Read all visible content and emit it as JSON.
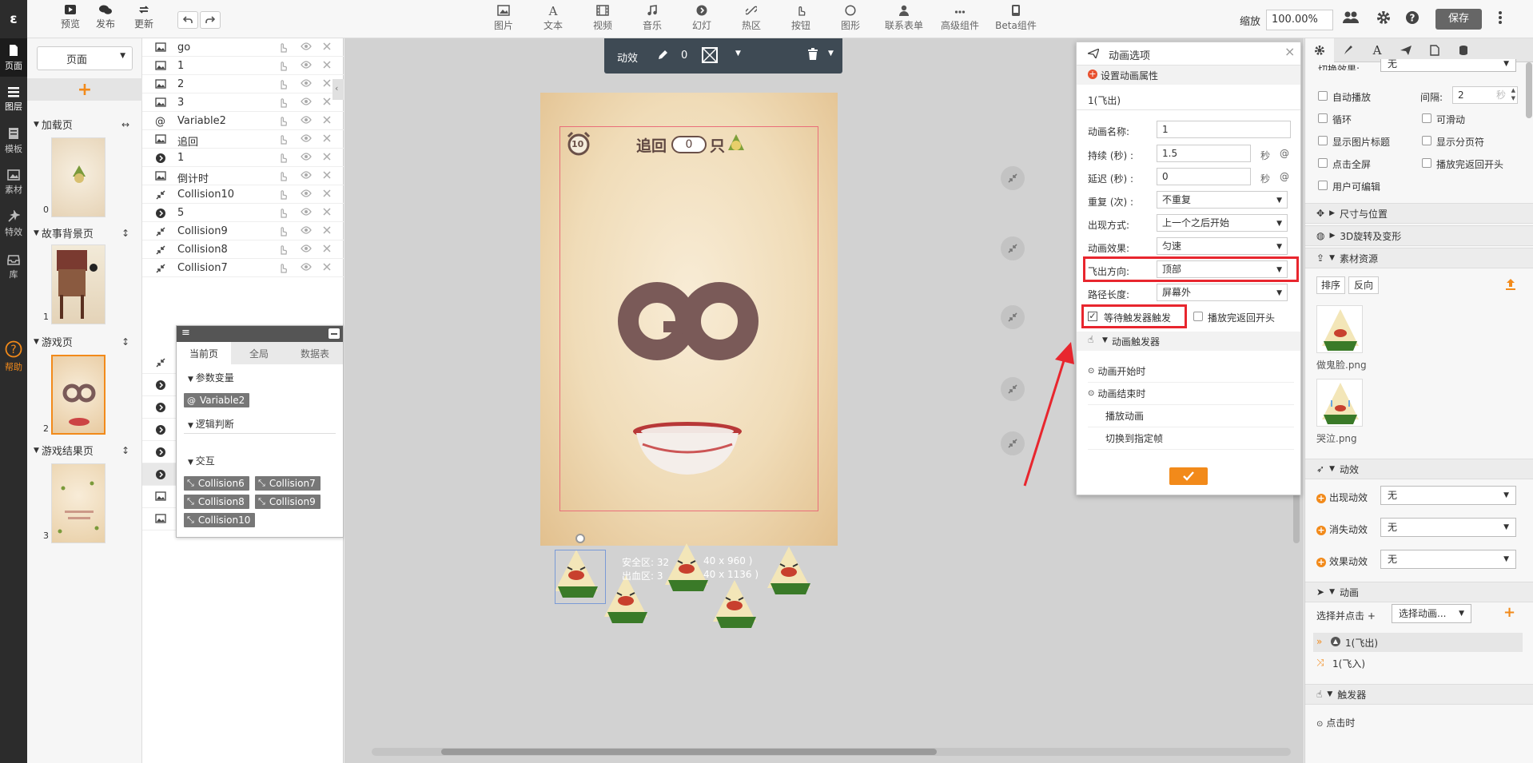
{
  "leftbar": {
    "logo": "ε",
    "items": [
      {
        "label": "页面",
        "icon": "page-icon"
      },
      {
        "label": "图层",
        "icon": "layers-icon"
      },
      {
        "label": "模板",
        "icon": "template-icon"
      },
      {
        "label": "素材",
        "icon": "image-icon"
      },
      {
        "label": "特效",
        "icon": "effect-icon"
      },
      {
        "label": "库",
        "icon": "library-icon"
      },
      {
        "label": "帮助",
        "icon": "help-icon"
      }
    ]
  },
  "toolbar": {
    "file_actions": [
      {
        "label": "预览",
        "icon": "preview-icon"
      },
      {
        "label": "发布",
        "icon": "publish-icon"
      },
      {
        "label": "更新",
        "icon": "update-icon"
      }
    ],
    "components": [
      {
        "label": "图片",
        "icon": "picture-icon"
      },
      {
        "label": "文本",
        "icon": "text-icon"
      },
      {
        "label": "视频",
        "icon": "video-icon"
      },
      {
        "label": "音乐",
        "icon": "music-icon"
      },
      {
        "label": "幻灯",
        "icon": "slideshow-icon"
      },
      {
        "label": "热区",
        "icon": "hotspot-icon"
      },
      {
        "label": "按钮",
        "icon": "button-icon"
      },
      {
        "label": "图形",
        "icon": "shape-icon"
      },
      {
        "label": "联系表单",
        "icon": "form-icon"
      },
      {
        "label": "高级组件",
        "icon": "advanced-icon"
      },
      {
        "label": "Beta组件",
        "icon": "beta-icon"
      }
    ],
    "zoom_label": "缩放",
    "zoom_value": "100.00%",
    "save_label": "保存"
  },
  "pages": {
    "select_value": "页面",
    "add_symbol": "+",
    "groups": [
      {
        "name": "加载页",
        "pages": [
          {
            "num": "0"
          }
        ]
      },
      {
        "name": "故事背景页",
        "pages": [
          {
            "num": "1"
          }
        ]
      },
      {
        "name": "游戏页",
        "pages": [
          {
            "num": "2"
          }
        ]
      },
      {
        "name": "游戏结果页",
        "pages": [
          {
            "num": "3"
          }
        ]
      }
    ],
    "group_icon": "↔",
    "group_icon2": "↕"
  },
  "layers": [
    {
      "name": "go",
      "icon": "image-layer"
    },
    {
      "name": "1",
      "icon": "image-layer"
    },
    {
      "name": "2",
      "icon": "image-layer"
    },
    {
      "name": "3",
      "icon": "image-layer"
    },
    {
      "name": "Variable2",
      "icon": "at-layer"
    },
    {
      "name": "追回",
      "icon": "image-layer"
    },
    {
      "name": "1",
      "icon": "circle-layer"
    },
    {
      "name": "倒计时",
      "icon": "image-layer"
    },
    {
      "name": "Collision10",
      "icon": "collision-layer"
    },
    {
      "name": "5",
      "icon": "circle-layer"
    },
    {
      "name": "Collision9",
      "icon": "collision-layer"
    },
    {
      "name": "Collision8",
      "icon": "collision-layer"
    },
    {
      "name": "Collision7",
      "icon": "collision-layer"
    }
  ],
  "var_panel": {
    "tabs": [
      "当前页",
      "全局",
      "数据表"
    ],
    "section_vars": "参数变量",
    "var_chips": [
      "Variable2"
    ],
    "section_logic": "逻辑判断",
    "section_interact": "交互",
    "interact_chips": [
      "Collision6",
      "Collision7",
      "Collision8",
      "Collision9",
      "Collision10"
    ]
  },
  "anim_toolbar": {
    "label": "动效",
    "count": "0"
  },
  "phone": {
    "title_left": "追回",
    "score": "0",
    "title_right": "只",
    "timer": "10",
    "go_text": "GO",
    "safe_zone_text": "安全区: 32",
    "safe_zone_text2": "40 x 960 )",
    "bleed_text": "出血区: 3",
    "bleed_text2": "40 x 1136 )"
  },
  "anim_dialog": {
    "title": "动画选项",
    "section": "设置动画属性",
    "anim_title": "1(飞出)",
    "fields": {
      "name_label": "动画名称:",
      "name_value": "1",
      "duration_label": "持续 (秒) :",
      "duration_value": "1.5",
      "delay_label": "延迟 (秒) :",
      "delay_value": "0",
      "sec_unit": "秒",
      "repeat_label": "重复 (次) :",
      "repeat_value": "不重复",
      "appear_label": "出现方式:",
      "appear_value": "上一个之后开始",
      "effect_label": "动画效果:",
      "effect_value": "匀速",
      "direction_label": "飞出方向:",
      "direction_value": "顶部",
      "path_label": "路径长度:",
      "path_value": "屏幕外"
    },
    "wait_trigger_label": "等待触发器触发",
    "wait_trigger_checked": true,
    "replay_label": "播放完返回开头",
    "trigger_section": "动画触发器",
    "triggers": [
      "动画开始时",
      "动画结束时",
      "播放动画",
      "切换到指定帧"
    ],
    "confirm_icon": "check-icon"
  },
  "right_panel": {
    "switch_effect_label": "切换效果:",
    "switch_effect_value": "无",
    "autoplay": "自动播放",
    "interval_label": "间隔:",
    "interval_value": "2",
    "interval_unit": "秒",
    "loop": "循环",
    "slidable": "可滑动",
    "show_img_title": "显示图片标题",
    "show_pager": "显示分页符",
    "click_fullscreen": "点击全屏",
    "replay_after": "播放完返回开头",
    "user_editable": "用户可编辑",
    "sec_size": "尺寸与位置",
    "sec_3d": "3D旋转及变形",
    "sec_assets": "素材资源",
    "sort_btn": "排序",
    "reverse_btn": "反向",
    "assets": [
      "做鬼脸.png",
      "哭泣.png"
    ],
    "sec_effects": "动效",
    "appear_effect": "出现动效",
    "disappear_effect": "消失动效",
    "effect_effect": "效果动效",
    "none_value": "无",
    "sec_anim": "动画",
    "select_click": "选择并点击 +",
    "select_anim": "选择动画...",
    "anim_items": [
      "1(飞出)",
      "1(飞入)"
    ],
    "sec_trigger": "触发器",
    "trigger_click": "点击时"
  },
  "colors": {
    "accent": "#f28a1a",
    "highlight_red": "#e8262e",
    "dark_bar": "#2c2c2c"
  }
}
